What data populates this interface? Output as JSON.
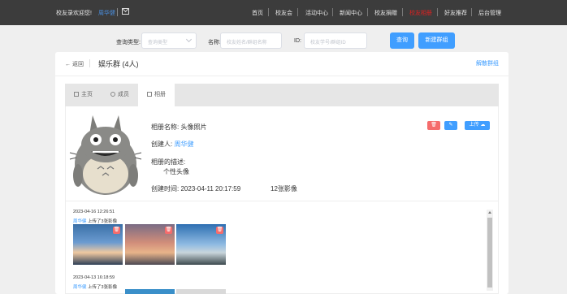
{
  "topbar": {
    "welcome": "校友录欢迎您!",
    "user": "周华健",
    "nav": [
      "首页",
      "校友会",
      "活动中心",
      "新闻中心",
      "校友捐赠",
      "校友相册",
      "好友推荐",
      "后台管理"
    ],
    "active_nav": "校友相册"
  },
  "search": {
    "type_label": "查询类型:",
    "type_placeholder": "查询类型",
    "name_label": "名称:",
    "name_placeholder": "校友姓名/群组名称",
    "id_label": "ID:",
    "id_placeholder": "校友学号/群组ID",
    "query_button": "查询",
    "new_group_button": "新建群组"
  },
  "header": {
    "back": "← 返回",
    "title": "娱乐群 (4人)",
    "dissolve": "解散群组"
  },
  "tabs": [
    {
      "label": "主页",
      "icon": "home-icon"
    },
    {
      "label": "成员",
      "icon": "user-icon"
    },
    {
      "label": "相册",
      "icon": "picture-icon"
    }
  ],
  "album": {
    "name_label": "相册名称:",
    "name": "头像照片",
    "creator_label": "创建人:",
    "creator": "周华健",
    "desc_label": "相册的描述:",
    "desc": "个性头像",
    "created_label": "创建时间:",
    "created": "2023-04-11 20:17:59",
    "count": "12张影像",
    "upload_button": "上传"
  },
  "feed": [
    {
      "time": "2023-04-16 12:26:51",
      "user": "周华健",
      "action": "上传了3张影像"
    },
    {
      "time": "2023-04-13 16:18:59",
      "user": "周华健",
      "action": "上传了3张影像"
    }
  ],
  "colors": {
    "primary": "#409eff",
    "danger": "#f56c6c",
    "active_nav": "#e02020",
    "topbar": "#3c3c3c"
  }
}
